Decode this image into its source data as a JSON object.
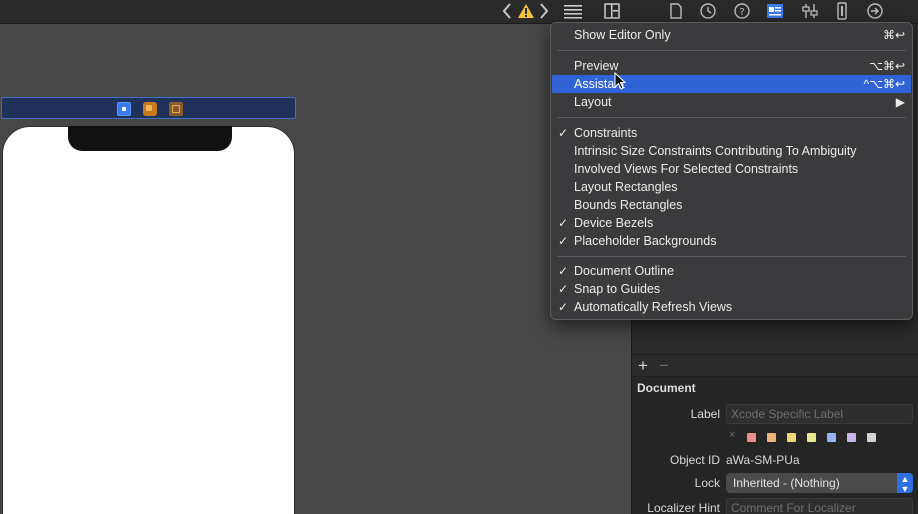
{
  "toolbar": {
    "icons": [
      "chevron-left-icon",
      "warning-icon",
      "chevron-right-icon",
      "lines-icon",
      "add-editor-icon",
      "file-icon",
      "history-icon",
      "help-icon",
      "identity-icon",
      "attributes-icon",
      "size-icon",
      "connections-icon"
    ],
    "accent": "#3a7bf0",
    "warning_color": "#f4c33a"
  },
  "menu": {
    "items": [
      {
        "label": "Show Editor Only",
        "shortcut": "⌘↩",
        "checked": false
      },
      {
        "label": "Preview",
        "shortcut": "⌥⌘↩",
        "checked": false
      },
      {
        "label": "Assistant",
        "shortcut": "^⌥⌘↩",
        "checked": false,
        "highlighted": true
      },
      {
        "label": "Layout",
        "shortcut": "▶",
        "checked": false
      },
      {
        "label": "Constraints",
        "checked": true
      },
      {
        "label": "Intrinsic Size Constraints Contributing To Ambiguity",
        "checked": false
      },
      {
        "label": "Involved Views For Selected Constraints",
        "checked": false
      },
      {
        "label": "Layout Rectangles",
        "checked": false
      },
      {
        "label": "Bounds Rectangles",
        "checked": false
      },
      {
        "label": "Device Bezels",
        "checked": true
      },
      {
        "label": "Placeholder Backgrounds",
        "checked": true
      },
      {
        "label": "Document Outline",
        "checked": true
      },
      {
        "label": "Snap to Guides",
        "checked": true
      },
      {
        "label": "Automatically Refresh Views",
        "checked": true
      }
    ],
    "check_glyph": "✓",
    "highlight_color": "#2f63d6"
  },
  "inspector": {
    "add_label": "+",
    "remove_label": "−",
    "section_title": "Document",
    "label_label": "Label",
    "label_placeholder": "Xcode Specific Label",
    "clear_glyph": "×",
    "swatches": [
      "#e8928a",
      "#efb57a",
      "#eed87c",
      "#e8e98e",
      "#94b4ef",
      "#c7b7ea",
      "#d4d4d4"
    ],
    "object_id_label": "Object ID",
    "object_id": "aWa-SM-PUa",
    "lock_label": "Lock",
    "lock_value": "Inherited - (Nothing)",
    "localizer_label": "Localizer Hint",
    "localizer_placeholder": "Comment For Localizer"
  }
}
